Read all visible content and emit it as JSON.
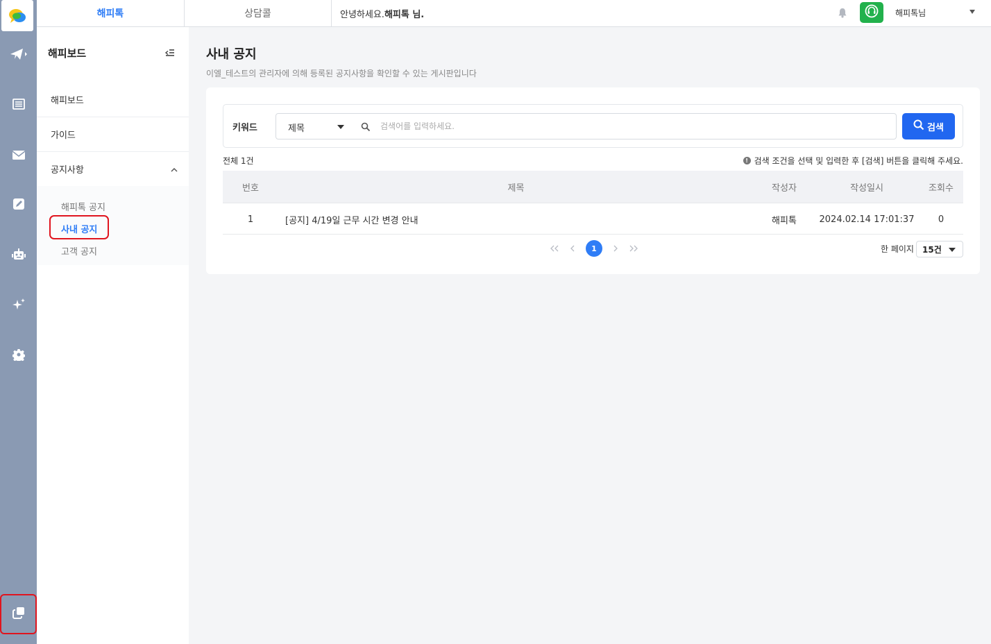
{
  "header": {
    "tabs": [
      {
        "label": "해피톡",
        "active": true
      },
      {
        "label": "상담콜",
        "active": false
      }
    ],
    "greeting_prefix": "안녕하세요.",
    "greeting_name": "해피톡 님.",
    "user_select_value": "해피톡님",
    "accent_color": "#2f7df6",
    "headset_color": "#22b14c"
  },
  "rail": {
    "icons": [
      "chat-logo-icon",
      "send-icon",
      "list-icon",
      "mail-icon",
      "edit-icon",
      "bot-icon",
      "sparkle-icon",
      "gear-icon",
      "copy-icon"
    ]
  },
  "subnav": {
    "title": "해피보드",
    "items": [
      {
        "label": "해피보드"
      },
      {
        "label": "가이드"
      },
      {
        "label": "공지사항",
        "expanded": true
      }
    ],
    "subitems": [
      {
        "label": "해피톡 공지",
        "active": false
      },
      {
        "label": "사내 공지",
        "active": true
      },
      {
        "label": "고객 공지",
        "active": false
      }
    ]
  },
  "main": {
    "title": "사내 공지",
    "description": "이엘_테스트의 관리자에 의해 등록된 공지사항을 확인할 수 있는 게시판입니다",
    "search": {
      "label": "키워드",
      "field_select": "제목",
      "placeholder": "검색어를 입력하세요.",
      "button": "검색"
    },
    "total": "전체 1건",
    "hint": "검색 조건을 선택 및 입력한 후 [검색] 버튼을 클릭해 주세요.",
    "table": {
      "columns": [
        "번호",
        "제목",
        "작성자",
        "작성일시",
        "조회수"
      ],
      "rows": [
        {
          "no": "1",
          "title": "[공지] 4/19일 근무 시간 변경 안내",
          "author": "해피톡",
          "date": "2024.02.14 17:01:37",
          "views": "0"
        }
      ]
    },
    "pagination": {
      "current": "1",
      "per_page_label": "한 페이지",
      "per_page_value": "15건"
    }
  }
}
